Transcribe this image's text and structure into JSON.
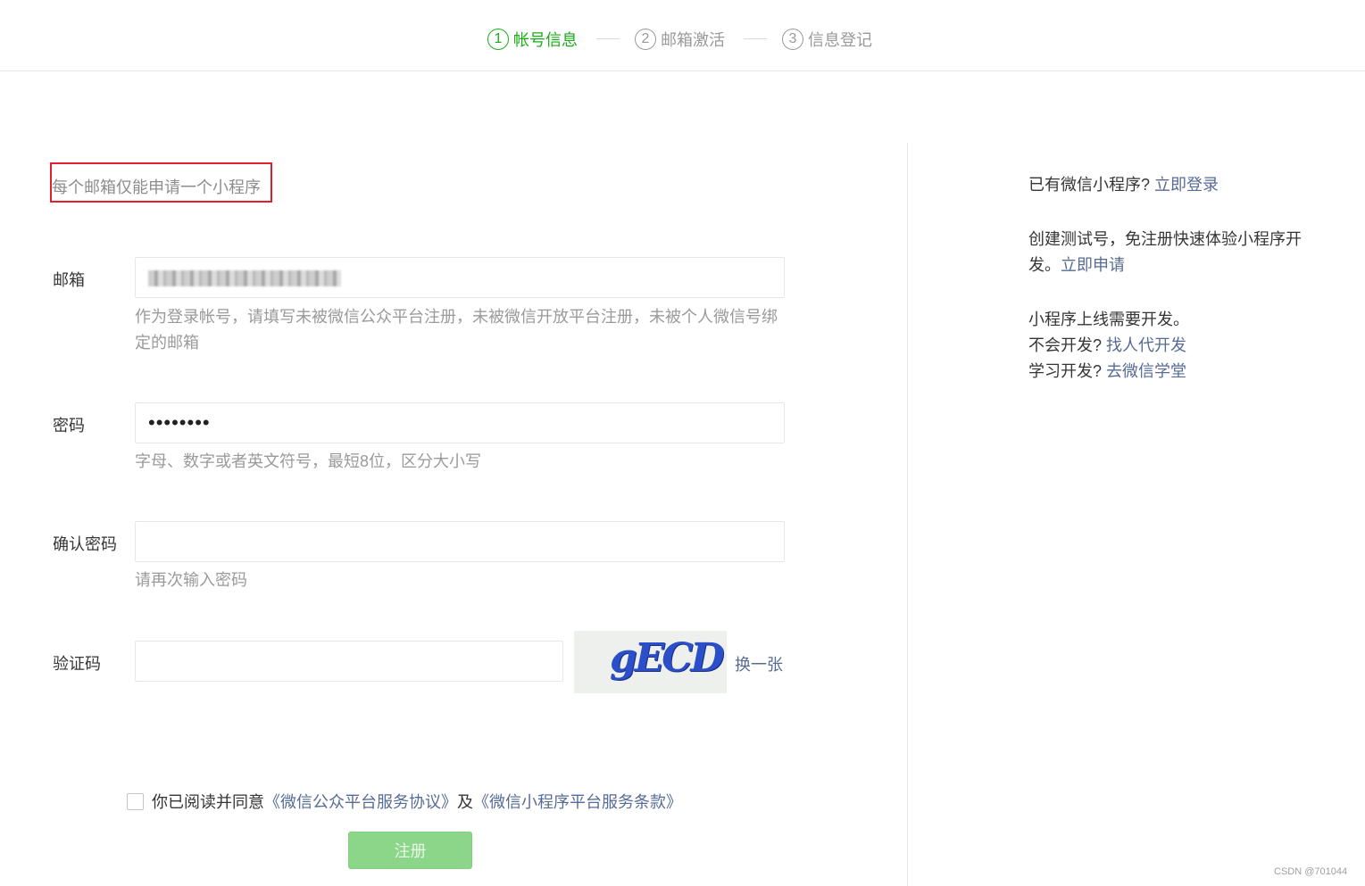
{
  "steps": [
    {
      "num": "1",
      "label": "帐号信息",
      "active": true
    },
    {
      "num": "2",
      "label": "邮箱激活",
      "active": false
    },
    {
      "num": "3",
      "label": "信息登记",
      "active": false
    }
  ],
  "notice": "每个邮箱仅能申请一个小程序",
  "form": {
    "email": {
      "label": "邮箱",
      "hint": "作为登录帐号，请填写未被微信公众平台注册，未被微信开放平台注册，未被个人微信号绑定的邮箱"
    },
    "password": {
      "label": "密码",
      "value": "••••••••",
      "hint": "字母、数字或者英文符号，最短8位，区分大小写"
    },
    "confirm": {
      "label": "确认密码",
      "hint": "请再次输入密码"
    },
    "captcha": {
      "label": "验证码",
      "image_text": "gECD",
      "refresh_label": "换一张"
    }
  },
  "agreement": {
    "prefix": "你已阅读并同意",
    "link1": "《微信公众平台服务协议》",
    "joiner": "及",
    "link2": "《微信小程序平台服务条款》"
  },
  "submit_label": "注册",
  "sidebar": {
    "login_prompt": "已有微信小程序?",
    "login_link": "立即登录",
    "test_line1": "创建测试号，免注册快速体验小程序开",
    "test_line2": "发。",
    "test_link": "立即申请",
    "dev_line": "小程序上线需要开发。",
    "hire_prompt": "不会开发?",
    "hire_link": "找人代开发",
    "learn_prompt": "学习开发?",
    "learn_link": "去微信学堂"
  },
  "watermark": "CSDN @701044",
  "colors": {
    "accent": "#1aad19",
    "link": "#576b95",
    "highlight_box": "#e0202d",
    "button_disabled": "#8cd68a"
  }
}
